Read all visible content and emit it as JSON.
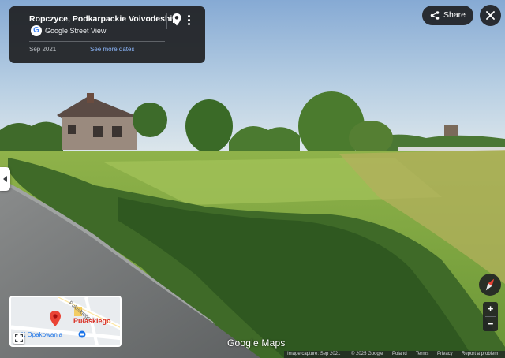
{
  "info_card": {
    "location": "Ropczyce, Podkarpackie Voivodeship",
    "source": "Google Street View",
    "capture_date": "Sep 2021",
    "see_more_label": "See more dates"
  },
  "actions": {
    "share_label": "Share"
  },
  "minimap": {
    "street_label": "Pułaskiego",
    "poi_label": "Pułaskiego",
    "shop_label": "K Opakowania"
  },
  "watermark": "Google Maps",
  "footer": {
    "image_capture": "Image capture: Sep 2021",
    "copyright": "© 2025 Google",
    "country": "Poland",
    "terms": "Terms",
    "privacy": "Privacy",
    "report": "Report a problem"
  },
  "controls": {
    "zoom_in": "+",
    "zoom_out": "−"
  },
  "colors": {
    "panel_bg": "#202124",
    "link_blue": "#8ab4f8",
    "pin_red": "#ea4335"
  },
  "icons": [
    "google-logo-icon",
    "pin-icon",
    "more-vert-icon",
    "share-icon",
    "close-icon",
    "chevron-left-icon",
    "compass-icon",
    "fullscreen-icon",
    "shop-icon"
  ]
}
